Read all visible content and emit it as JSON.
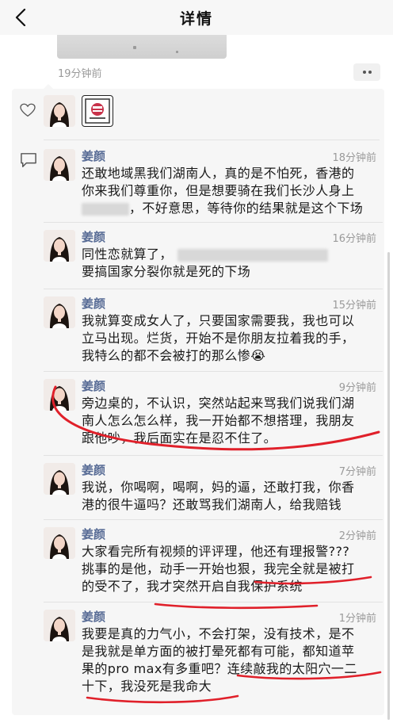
{
  "header": {
    "title": "详情",
    "back_icon": "chevron-left-icon"
  },
  "post": {
    "time": "19分钟前",
    "more_icon": "more-dots-icon"
  },
  "likes": {
    "icon": "heart-icon"
  },
  "comments_icon": "comment-bubble-icon",
  "comments": [
    {
      "name": "姜颜",
      "time": "18分钟前",
      "lines": [
        "还敢地域黑我们湖南人，真的是不怕死，香港的",
        "你来我们尊重你，但是想要骑在我们长沙人身上",
        "，不好意思，等待你的结果就是这个下场"
      ]
    },
    {
      "name": "姜颜",
      "time": "16分钟前",
      "lines": [
        "同性恋就算了，",
        "要搞国家分裂你就是死的下场"
      ]
    },
    {
      "name": "姜颜",
      "time": "15分钟前",
      "lines": [
        "我就算变成女人了，只要国家需要我，我也可以",
        "立马出现。烂货，开始不是你朋友拉着我的手，",
        "我特么的都不会被打的那么惨😭"
      ]
    },
    {
      "name": "姜颜",
      "time": "9分钟前",
      "lines": [
        "旁边桌的，不认识，突然站起来骂我们说我们湖",
        "南人怎么怎么样，我一开始都不想搭理，我朋友",
        "跟他吵，我后面实在是忍不住了。"
      ]
    },
    {
      "name": "姜颜",
      "time": "7分钟前",
      "lines": [
        "我说，你喝啊，喝啊，妈的逼，还敢打我，你香",
        "港的很牛逼吗？还敢骂我们湖南人，给我赔钱"
      ]
    },
    {
      "name": "姜颜",
      "time": "2分钟前",
      "lines": [
        "大家看完所有视频的评评理，他还有理报警???",
        "挑事的是他，动手一开始也狠，我完全就是被打",
        "的受不了，我才突然开启自我保护系统"
      ]
    },
    {
      "name": "姜颜",
      "time": "1分钟前",
      "lines": [
        "我要是真的力气小，不会打架，没有技术，是不",
        "是我就是单方面的被打晕死都有可能，都知道苹",
        "果的pro max有多重吧？连续敲我的太阳穴一二",
        "十下，我没死是我命大"
      ]
    }
  ],
  "colors": {
    "name": "#576b95",
    "time": "#9a9a9a",
    "panel": "#f6f6f6",
    "annotation": "#e0202a"
  }
}
